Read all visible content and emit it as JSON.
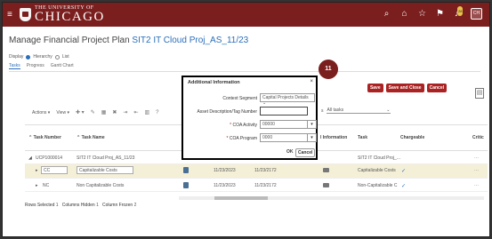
{
  "header": {
    "brand_small": "THE UNIVERSITY OF",
    "brand_big": "CHICAGO",
    "notification_count": "28",
    "avatar_initials": "CH"
  },
  "page": {
    "title_prefix": "Manage Financial Project Plan",
    "title_project": "SIT2 IT Cloud Proj_AS_11/23",
    "display_label": "Display",
    "display_options": [
      "Hierarchy",
      "List"
    ],
    "display_selected": "Hierarchy",
    "tabs": [
      "Tasks",
      "Progress",
      "Gantt Chart"
    ],
    "active_tab": "Tasks"
  },
  "actions": {
    "save": "Save",
    "save_close": "Save and Close",
    "cancel": "Cancel"
  },
  "toolbar": {
    "actions": "Actions",
    "view": "View"
  },
  "filter": {
    "label": "s",
    "value": "All tasks"
  },
  "table": {
    "headers": {
      "task_number": "Task Number",
      "task_name": "Task Name",
      "information": "l Information",
      "task": "Task",
      "chargeable": "Chargeable",
      "critical": "Critic"
    },
    "rows": [
      {
        "number": "UCP1000014",
        "name": "SIT2 IT Cloud Proj_AS_11/23",
        "start": "",
        "finish": "",
        "task": "SIT2 IT Cloud Proj_...",
        "chargeable": ""
      },
      {
        "number": "CC",
        "name": "Capitalizable Costs",
        "start": "11/23/2023",
        "finish": "11/23/2172",
        "task": "Capitalizable Costs",
        "chargeable": "✓"
      },
      {
        "number": "NC",
        "name": "Non Capitalizable Costs",
        "start": "11/23/2023",
        "finish": "11/23/2172",
        "task": "Non-Capitalizable C",
        "chargeable": "✓"
      }
    ]
  },
  "footer": {
    "rows_selected_label": "Rows Selected",
    "rows_selected": "1",
    "columns_hidden_label": "Columns Hidden",
    "columns_hidden": "1",
    "columns_frozen_label": "Column Frozen",
    "columns_frozen": "2"
  },
  "modal": {
    "title": "Additional Information",
    "context_segment_label": "Context Segment",
    "context_segment_value": "Capital Projects Details",
    "asset_desc_label": "Asset Description/Tag Number",
    "asset_desc_value": "",
    "coa_activity_label": "COA Activity",
    "coa_activity_value": "00000",
    "coa_program_label": "COA Program",
    "coa_program_value": "0000",
    "ok": "OK",
    "cancel": "Cancel"
  },
  "step_badge": "11",
  "colors": {
    "brand": "#7a1e1e",
    "accent": "#2a6ebb",
    "action_button": "#a22222"
  }
}
